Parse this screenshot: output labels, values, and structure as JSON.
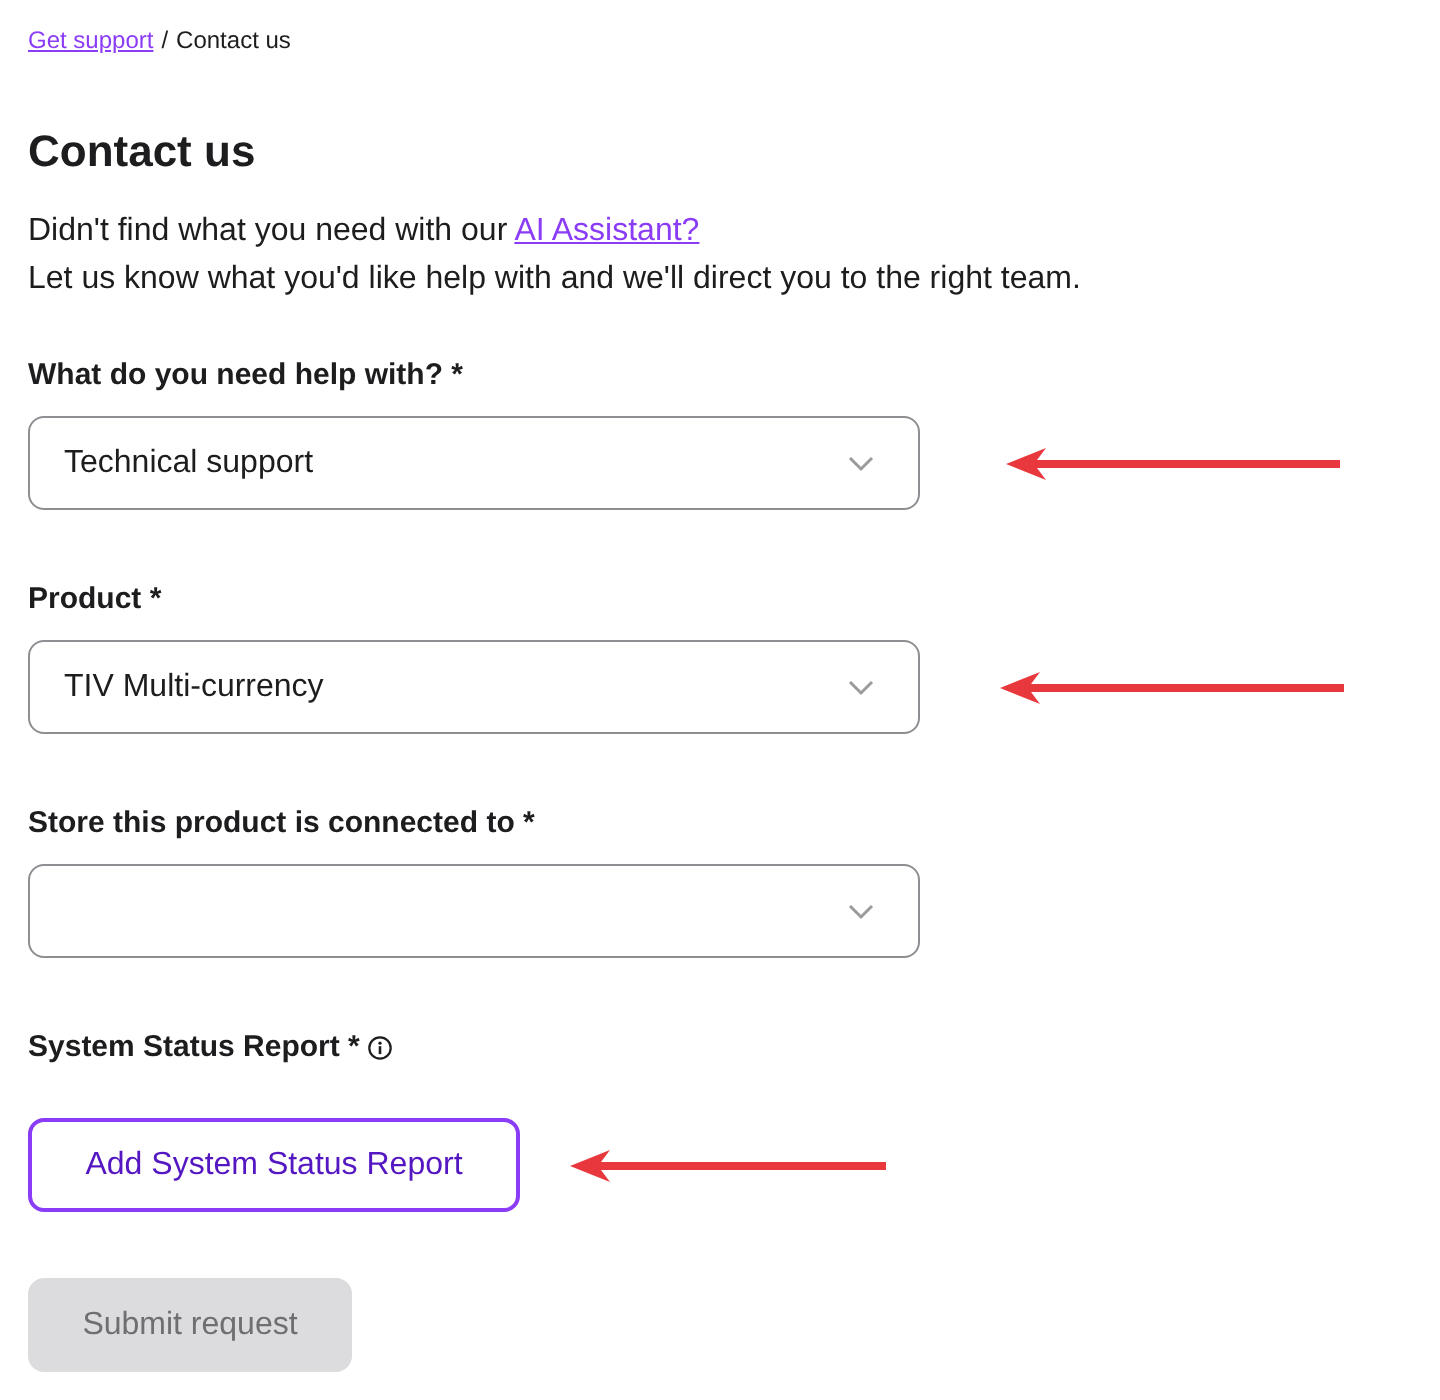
{
  "breadcrumb": {
    "link": "Get support",
    "separator": "/",
    "current": "Contact us"
  },
  "title": "Contact us",
  "intro": {
    "text": "Didn't find what you need with our",
    "link": "AI Assistant?",
    "line_2": "Let us know what you'd like help with and we'll direct you to the right team."
  },
  "fields": [
    {
      "label": "What do you need help with? *",
      "value": "Technical support",
      "arrow": true
    },
    {
      "label": "Product *",
      "value": "TIV Multi-currency",
      "arrow": true
    },
    {
      "label": "Store this product is connected to *",
      "arrow": false
    }
  ],
  "status_report": {
    "label": "System Status Report *",
    "button": "Add System Status Report",
    "arrow": true
  },
  "submit": {
    "label": "Submit request",
    "disabled": true
  }
}
